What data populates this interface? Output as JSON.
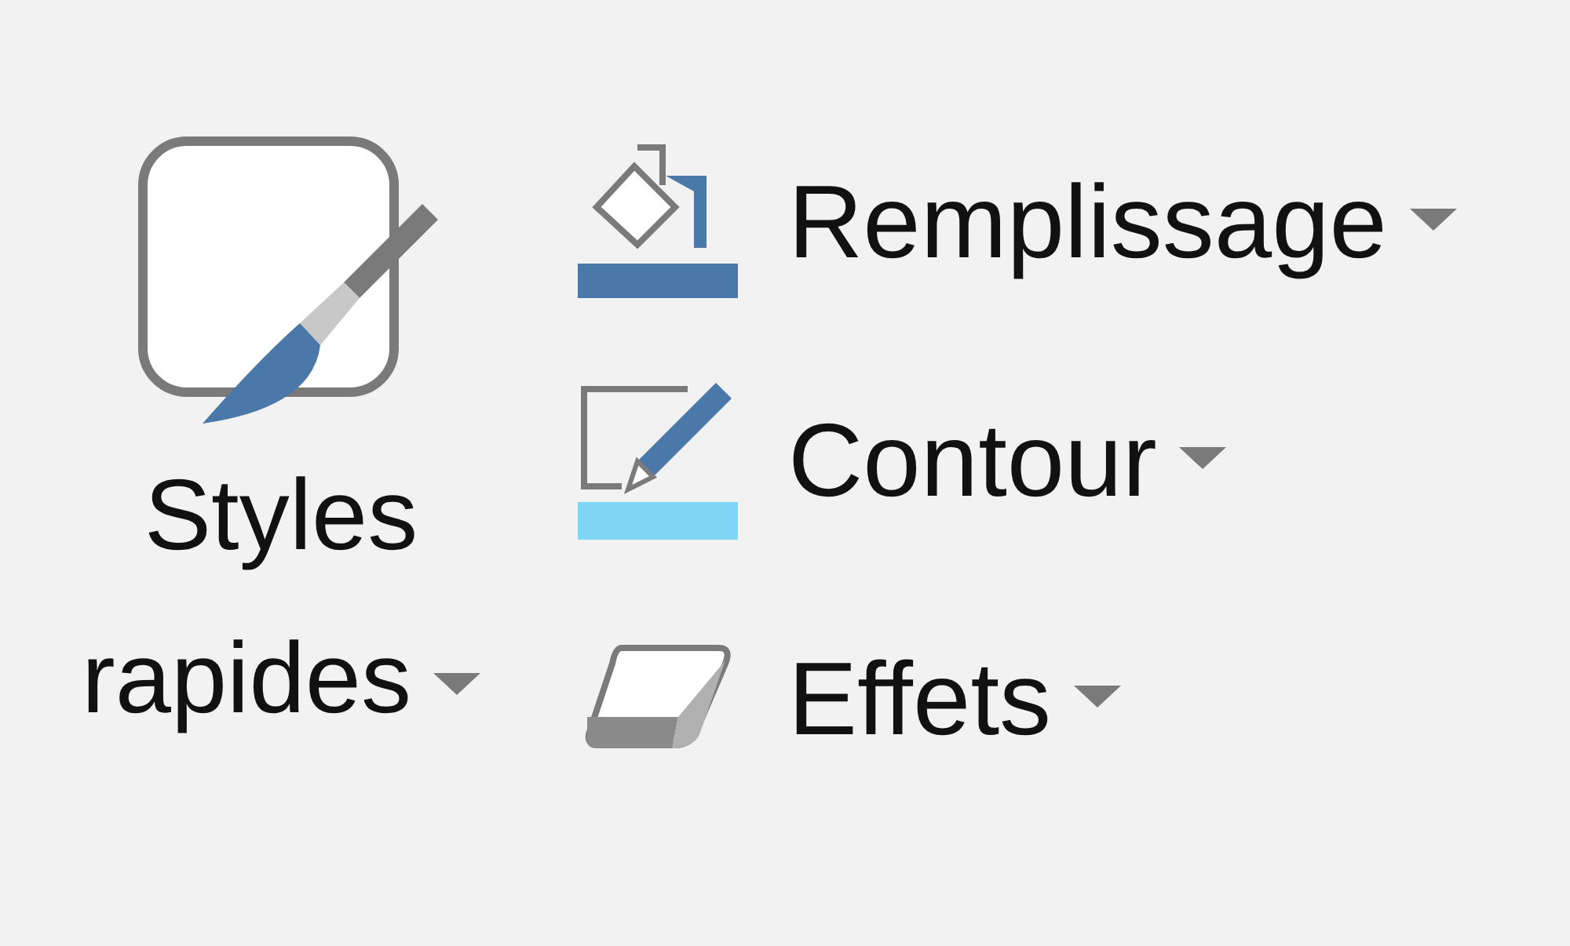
{
  "quick_styles": {
    "label": "Styles rapides"
  },
  "commands": [
    {
      "kind": "fill",
      "label": "Remplissage"
    },
    {
      "kind": "outline",
      "label": "Contour"
    },
    {
      "kind": "effects",
      "label": "Effets"
    }
  ]
}
